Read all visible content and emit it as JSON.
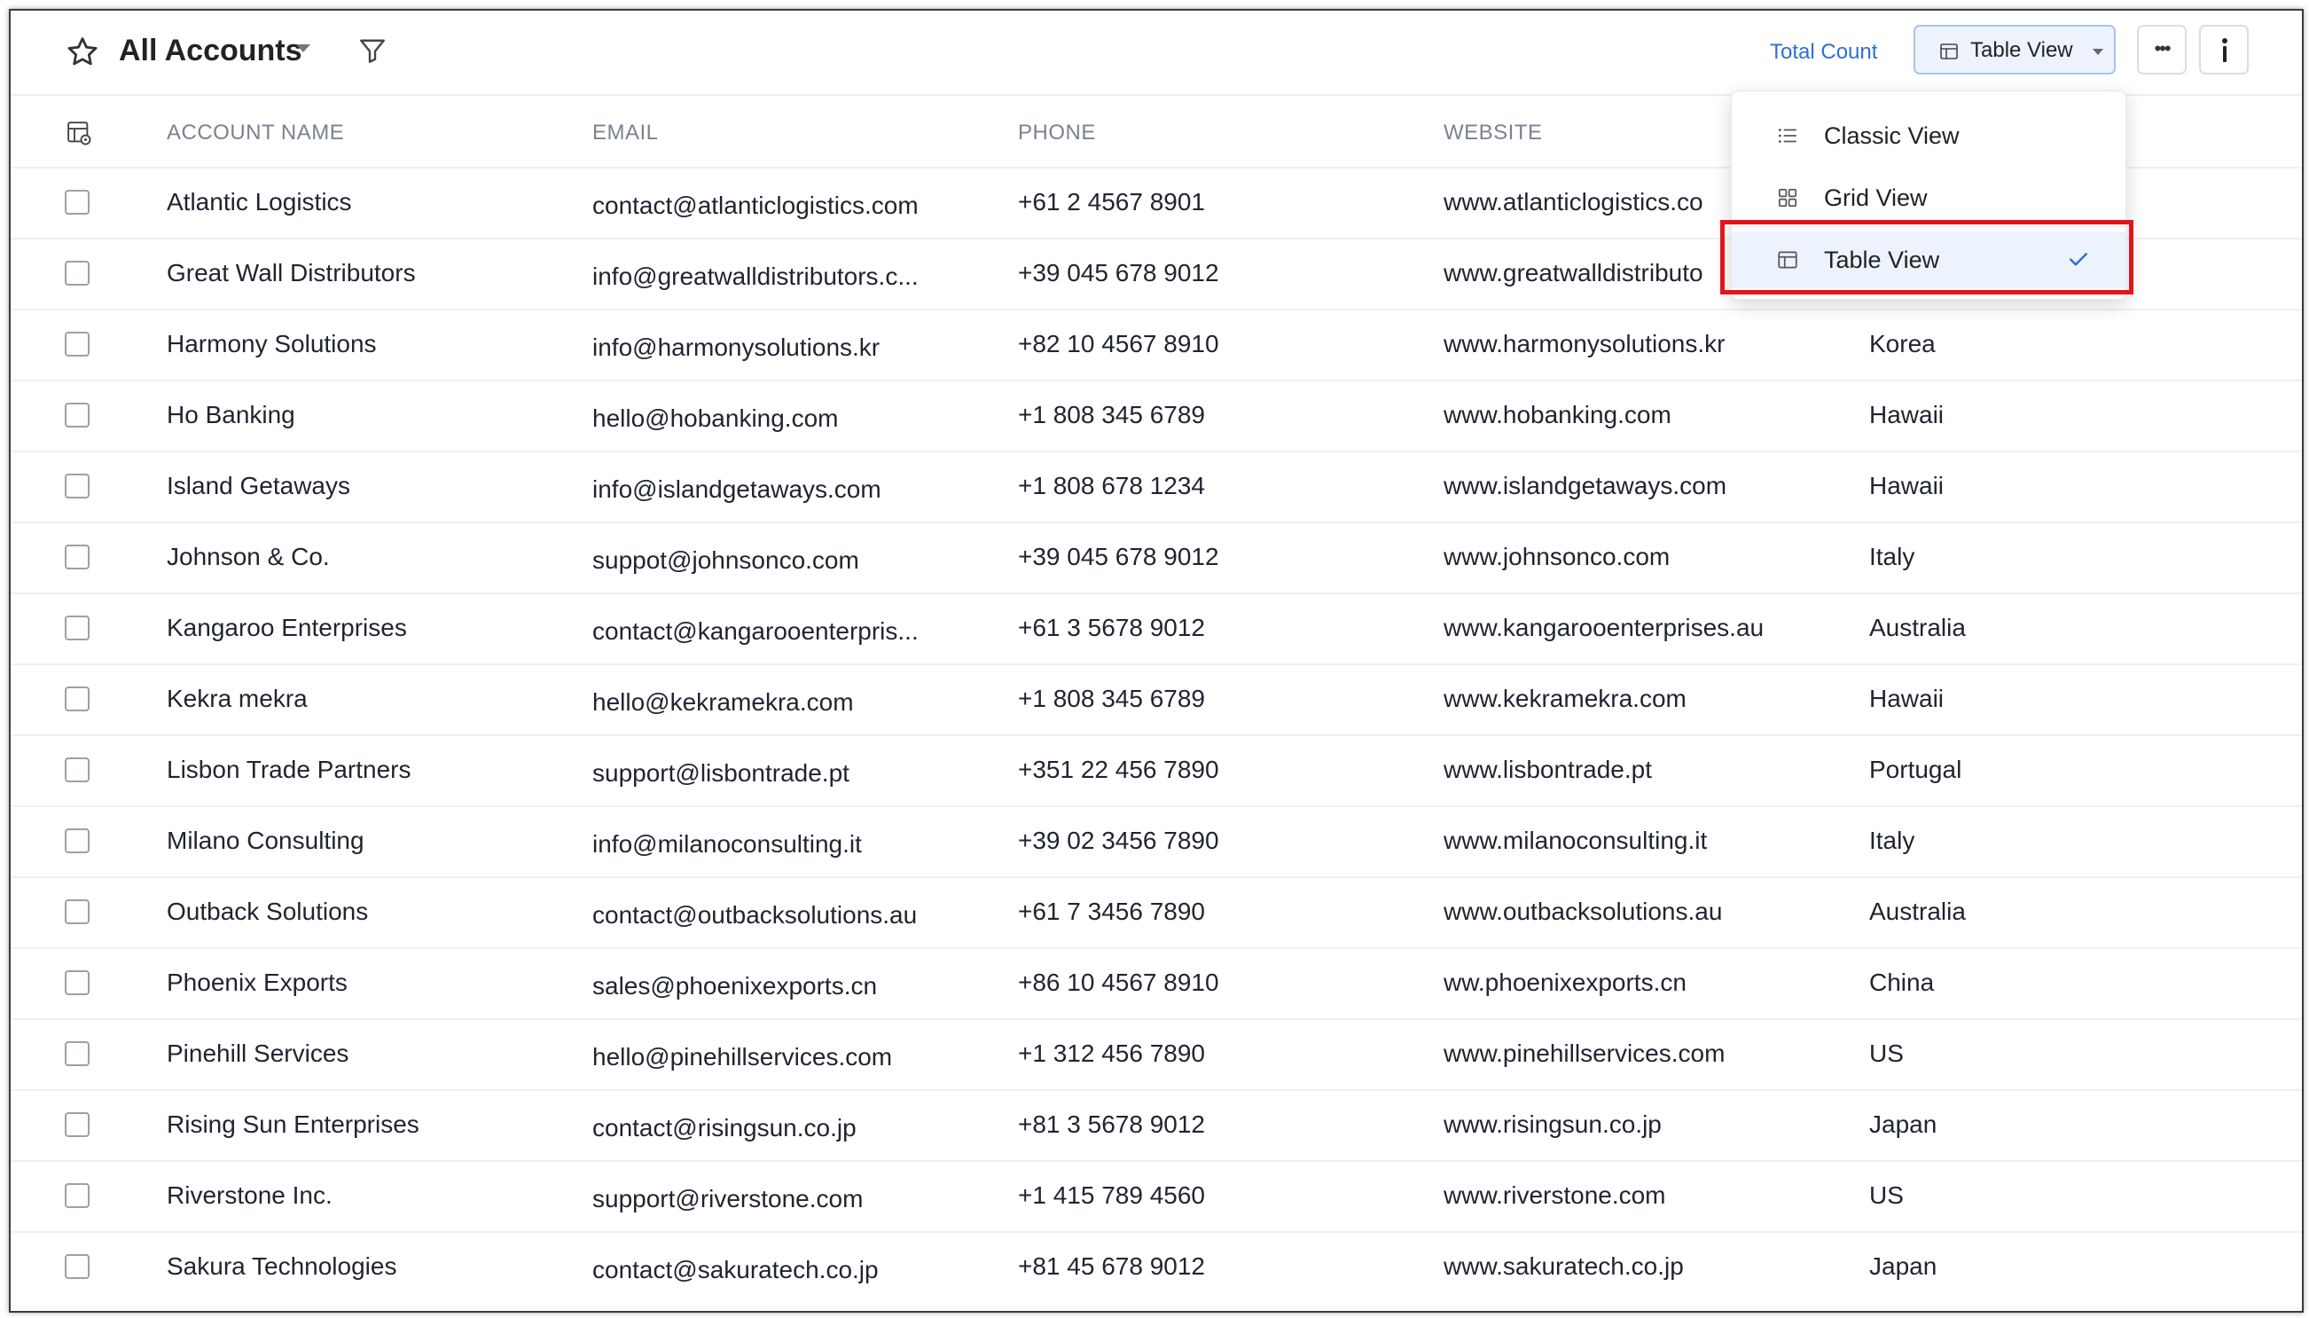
{
  "header": {
    "title": "All Accounts",
    "total_count_label": "Total Count",
    "view_button_label": "Table View",
    "more_label": "•••"
  },
  "columns": [
    "ACCOUNT NAME",
    "EMAIL",
    "PHONE",
    "WEBSITE"
  ],
  "rows": [
    {
      "name": "Atlantic Logistics",
      "email": "contact@atlanticlogistics.com",
      "phone": "+61 2 4567 8901",
      "website": "www.atlanticlogistics.co",
      "country": ""
    },
    {
      "name": "Great Wall Distributors",
      "email": "info@greatwalldistributors.c...",
      "phone": "+39 045 678 9012",
      "website": "www.greatwalldistributo",
      "country": ""
    },
    {
      "name": "Harmony Solutions",
      "email": "info@harmonysolutions.kr",
      "phone": "+82 10 4567 8910",
      "website": "www.harmonysolutions.kr",
      "country": "Korea"
    },
    {
      "name": "Ho Banking",
      "email": "hello@hobanking.com",
      "phone": "+1 808 345 6789",
      "website": "www.hobanking.com",
      "country": "Hawaii"
    },
    {
      "name": "Island Getaways",
      "email": "info@islandgetaways.com",
      "phone": "+1 808 678 1234",
      "website": "www.islandgetaways.com",
      "country": "Hawaii"
    },
    {
      "name": "Johnson & Co.",
      "email": "suppot@johnsonco.com",
      "phone": "+39 045 678 9012",
      "website": "www.johnsonco.com",
      "country": "Italy"
    },
    {
      "name": "Kangaroo Enterprises",
      "email": "contact@kangarooenterpris...",
      "phone": "+61 3 5678 9012",
      "website": "www.kangarooenterprises.au",
      "country": "Australia"
    },
    {
      "name": "Kekra mekra",
      "email": "hello@kekramekra.com",
      "phone": "+1 808 345 6789",
      "website": "www.kekramekra.com",
      "country": "Hawaii"
    },
    {
      "name": "Lisbon Trade Partners",
      "email": "support@lisbontrade.pt",
      "phone": "+351 22 456 7890",
      "website": "www.lisbontrade.pt",
      "country": "Portugal"
    },
    {
      "name": "Milano Consulting",
      "email": "info@milanoconsulting.it",
      "phone": "+39 02 3456 7890",
      "website": "www.milanoconsulting.it",
      "country": "Italy"
    },
    {
      "name": "Outback Solutions",
      "email": "contact@outbacksolutions.au",
      "phone": "+61 7 3456 7890",
      "website": "www.outbacksolutions.au",
      "country": "Australia"
    },
    {
      "name": "Phoenix Exports",
      "email": "sales@phoenixexports.cn",
      "phone": "+86 10 4567 8910",
      "website": "ww.phoenixexports.cn",
      "country": "China"
    },
    {
      "name": "Pinehill Services",
      "email": "hello@pinehillservices.com",
      "phone": "+1 312 456 7890",
      "website": "www.pinehillservices.com",
      "country": "US"
    },
    {
      "name": "Rising Sun Enterprises",
      "email": "contact@risingsun.co.jp",
      "phone": "+81 3 5678 9012",
      "website": "www.risingsun.co.jp",
      "country": "Japan"
    },
    {
      "name": "Riverstone Inc.",
      "email": "support@riverstone.com",
      "phone": "+1 415 789 4560",
      "website": "www.riverstone.com",
      "country": "US"
    },
    {
      "name": "Sakura Technologies",
      "email": "contact@sakuratech.co.jp",
      "phone": "+81 45 678 9012",
      "website": "www.sakuratech.co.jp",
      "country": "Japan"
    }
  ],
  "dropdown": {
    "items": [
      {
        "label": "Classic View",
        "icon": "list-icon"
      },
      {
        "label": "Grid View",
        "icon": "grid-icon"
      },
      {
        "label": "Table View",
        "icon": "table-icon",
        "selected": true
      }
    ]
  },
  "colors": {
    "accent": "#2f6fd6",
    "highlight": "#e3141c",
    "selected_bg": "#edf3fc"
  }
}
